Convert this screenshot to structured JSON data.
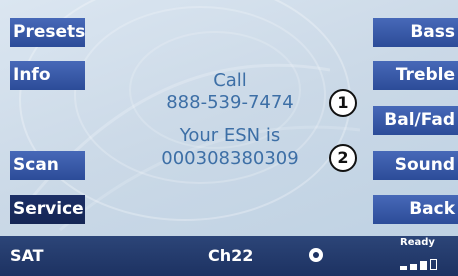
{
  "left_buttons": {
    "presets": "Presets",
    "info": "Info",
    "scan": "Scan",
    "service": "Service"
  },
  "right_buttons": {
    "bass": "Bass",
    "treble": "Treble",
    "bal_fad": "Bal/Fad",
    "sound": "Sound",
    "back": "Back"
  },
  "message": {
    "line1": "Call",
    "line2": "888-539-7474",
    "line3": "Your ESN is",
    "line4": "000308380309"
  },
  "markers": {
    "one": "1",
    "two": "2"
  },
  "status_bar": {
    "band": "SAT",
    "channel": "Ch22",
    "ready": "Ready",
    "dot_icon": "radio-dot-icon",
    "signal_icon": "signal-strength-icon",
    "signal_level": "3/4"
  },
  "colors": {
    "button_blue": "#3a5dae",
    "button_selected": "#1a2c60",
    "message_text": "#3d6fa6",
    "status_bar": "#243a6c"
  }
}
